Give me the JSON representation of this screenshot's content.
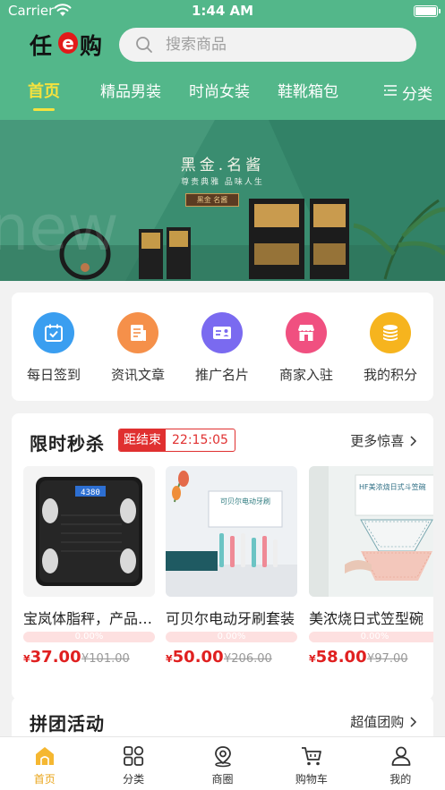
{
  "status_bar": {
    "carrier": "Carrier",
    "time": "1:44 AM"
  },
  "logo": {
    "char1": "任",
    "char2": "e",
    "char3": "购"
  },
  "search": {
    "placeholder": "搜索商品"
  },
  "tabs": [
    {
      "label": "首页",
      "active": true
    },
    {
      "label": "精品男装"
    },
    {
      "label": "时尚女装"
    },
    {
      "label": "鞋靴箱包"
    }
  ],
  "category_button": {
    "label": "分类",
    "icon": "list-icon"
  },
  "banner": {
    "title": "黑金.名酱",
    "subtitle": "尊贵典雅 品味人生",
    "tag": "黑金 名酱",
    "watermark": "new"
  },
  "quick_menu": [
    {
      "label": "每日签到",
      "icon": "calendar-check-icon",
      "color": "#3a9ef0"
    },
    {
      "label": "资讯文章",
      "icon": "article-icon",
      "color": "#f5904a"
    },
    {
      "label": "推广名片",
      "icon": "card-icon",
      "color": "#7a6af0"
    },
    {
      "label": "商家入驻",
      "icon": "store-icon",
      "color": "#f05080"
    },
    {
      "label": "我的积分",
      "icon": "coins-icon",
      "color": "#f6b41e"
    }
  ],
  "flash_sale": {
    "title": "限时秒杀",
    "countdown_label": "距结束",
    "countdown": "22:15:05",
    "more": "更多惊喜",
    "products": [
      {
        "name": "宝岚体脂秤，产品名称",
        "progress": "0.00%",
        "currency": "¥",
        "price": "37.00",
        "old_price": "¥101.00",
        "scale_display": "4380"
      },
      {
        "name": "可贝尔电动牙刷套装",
        "progress": "0.00%",
        "currency": "¥",
        "price": "50.00",
        "old_price": "¥206.00",
        "box_text": "可贝尔电动牙刷"
      },
      {
        "name": "美浓烧日式笠型碗",
        "progress": "0.00%",
        "currency": "¥",
        "price": "58.00",
        "old_price": "¥97.00",
        "box_text": "HF美浓烧日式斗笠碗"
      }
    ]
  },
  "group_buy": {
    "title": "拼团活动",
    "more": "超值团购"
  },
  "tabbar": [
    {
      "label": "首页",
      "icon": "home-icon",
      "active": true
    },
    {
      "label": "分类",
      "icon": "grid-icon"
    },
    {
      "label": "商圈",
      "icon": "location-icon"
    },
    {
      "label": "购物车",
      "icon": "cart-icon"
    },
    {
      "label": "我的",
      "icon": "user-icon"
    }
  ],
  "colors": {
    "brand_green": "#53b78a",
    "accent_yellow": "#f5e23e",
    "price_red": "#e02020",
    "tab_active": "#e9a418"
  }
}
